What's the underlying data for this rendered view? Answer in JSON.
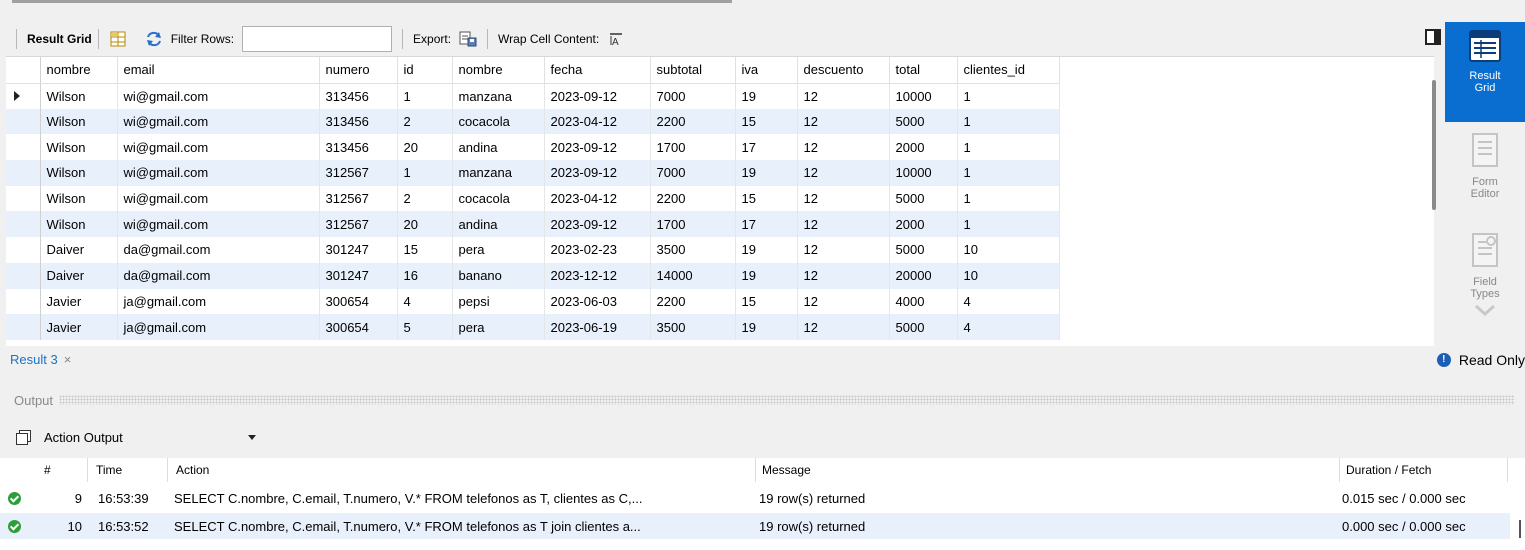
{
  "toolbar": {
    "result_grid_label": "Result Grid",
    "filter_rows_label": "Filter Rows:",
    "filter_value": "",
    "export_label": "Export:",
    "wrap_label": "Wrap Cell Content:"
  },
  "grid": {
    "columns": [
      "nombre",
      "email",
      "numero",
      "id",
      "nombre",
      "fecha",
      "subtotal",
      "iva",
      "descuento",
      "total",
      "clientes_id"
    ],
    "rows": [
      [
        "Wilson",
        "wi@gmail.com",
        "313456",
        "1",
        "manzana",
        "2023-09-12",
        "7000",
        "19",
        "12",
        "10000",
        "1"
      ],
      [
        "Wilson",
        "wi@gmail.com",
        "313456",
        "2",
        "cocacola",
        "2023-04-12",
        "2200",
        "15",
        "12",
        "5000",
        "1"
      ],
      [
        "Wilson",
        "wi@gmail.com",
        "313456",
        "20",
        "andina",
        "2023-09-12",
        "1700",
        "17",
        "12",
        "2000",
        "1"
      ],
      [
        "Wilson",
        "wi@gmail.com",
        "312567",
        "1",
        "manzana",
        "2023-09-12",
        "7000",
        "19",
        "12",
        "10000",
        "1"
      ],
      [
        "Wilson",
        "wi@gmail.com",
        "312567",
        "2",
        "cocacola",
        "2023-04-12",
        "2200",
        "15",
        "12",
        "5000",
        "1"
      ],
      [
        "Wilson",
        "wi@gmail.com",
        "312567",
        "20",
        "andina",
        "2023-09-12",
        "1700",
        "17",
        "12",
        "2000",
        "1"
      ],
      [
        "Daiver",
        "da@gmail.com",
        "301247",
        "15",
        "pera",
        "2023-02-23",
        "3500",
        "19",
        "12",
        "5000",
        "10"
      ],
      [
        "Daiver",
        "da@gmail.com",
        "301247",
        "16",
        "banano",
        "2023-12-12",
        "14000",
        "19",
        "12",
        "20000",
        "10"
      ],
      [
        "Javier",
        "ja@gmail.com",
        "300654",
        "4",
        "pepsi",
        "2023-06-03",
        "2200",
        "15",
        "12",
        "4000",
        "4"
      ],
      [
        "Javier",
        "ja@gmail.com",
        "300654",
        "5",
        "pera",
        "2023-06-19",
        "3500",
        "19",
        "12",
        "5000",
        "4"
      ]
    ]
  },
  "sidepanel": {
    "result_grid": "Result Grid",
    "form_editor": "Form Editor",
    "field_types": "Field Types"
  },
  "result_tab": {
    "label": "Result 3",
    "close": "×"
  },
  "status": {
    "read_only": "Read Only",
    "info_glyph": "!"
  },
  "output": {
    "title": "Output",
    "selector_value": "Action Output",
    "headers": {
      "num": "#",
      "time": "Time",
      "action": "Action",
      "message": "Message",
      "duration": "Duration / Fetch"
    },
    "rows": [
      {
        "num": "9",
        "time": "16:53:39",
        "action": "SELECT C.nombre, C.email, T.numero, V.* FROM telefonos as T, clientes as C,...",
        "message": "19 row(s) returned",
        "duration": "0.015 sec / 0.000 sec"
      },
      {
        "num": "10",
        "time": "16:53:52",
        "action": "SELECT C.nombre, C.email, T.numero, V.* FROM telefonos as T join clientes a...",
        "message": "19 row(s) returned",
        "duration": "0.000 sec / 0.000 sec"
      }
    ]
  },
  "colors": {
    "accent": "#0a6ed1",
    "alt_row": "#e8f0fb",
    "ok": "#2e9e3a",
    "link": "#1a73c8"
  }
}
